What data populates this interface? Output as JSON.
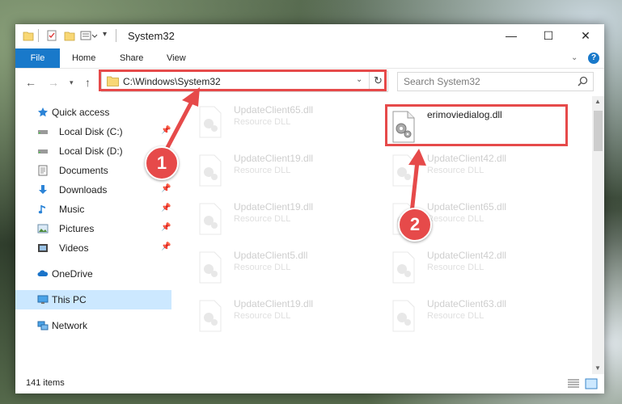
{
  "window": {
    "title": "System32",
    "minimize_icon": "minimize-icon",
    "maximize_icon": "maximize-icon",
    "close_icon": "close-icon"
  },
  "ribbon": {
    "tabs": [
      {
        "label": "File"
      },
      {
        "label": "Home"
      },
      {
        "label": "Share"
      },
      {
        "label": "View"
      }
    ]
  },
  "navigation": {
    "address": "C:\\Windows\\System32",
    "search_placeholder": "Search System32"
  },
  "sidebar": {
    "items": [
      {
        "label": "Quick access",
        "icon": "star-icon"
      },
      {
        "label": "Local Disk (C:)",
        "icon": "drive-icon"
      },
      {
        "label": "Local Disk (D:)",
        "icon": "drive-icon"
      },
      {
        "label": "Documents",
        "icon": "documents-icon"
      },
      {
        "label": "Downloads",
        "icon": "downloads-icon"
      },
      {
        "label": "Music",
        "icon": "music-icon"
      },
      {
        "label": "Pictures",
        "icon": "pictures-icon"
      },
      {
        "label": "Videos",
        "icon": "videos-icon"
      },
      {
        "label": "OneDrive",
        "icon": "cloud-icon"
      },
      {
        "label": "This PC",
        "icon": "computer-icon"
      },
      {
        "label": "Network",
        "icon": "network-icon"
      }
    ]
  },
  "files": {
    "highlighted": {
      "name": "erimoviedialog.dll"
    },
    "items": [
      {
        "name": "UpdateClient65.dll",
        "type": "Resource DLL"
      },
      {
        "name": "UpdateClient19.dll",
        "type": "Resource DLL"
      },
      {
        "name": "UpdateClient42.dll",
        "type": "Resource DLL"
      },
      {
        "name": "UpdateClient19.dll",
        "type": "Resource DLL"
      },
      {
        "name": "UpdateClient65.dll",
        "type": "Resource DLL"
      },
      {
        "name": "UpdateClient5.dll",
        "type": "Resource DLL"
      },
      {
        "name": "UpdateClient42.dll",
        "type": "Resource DLL"
      },
      {
        "name": "UpdateClient19.dll",
        "type": "Resource DLL"
      },
      {
        "name": "UpdateClient63.dll",
        "type": "Resource DLL"
      }
    ]
  },
  "status": {
    "item_count": "141 items"
  },
  "callouts": {
    "step1": "1",
    "step2": "2"
  },
  "colors": {
    "accent": "#1979ca",
    "highlight": "#e64a4a",
    "selection": "#cce8ff"
  }
}
